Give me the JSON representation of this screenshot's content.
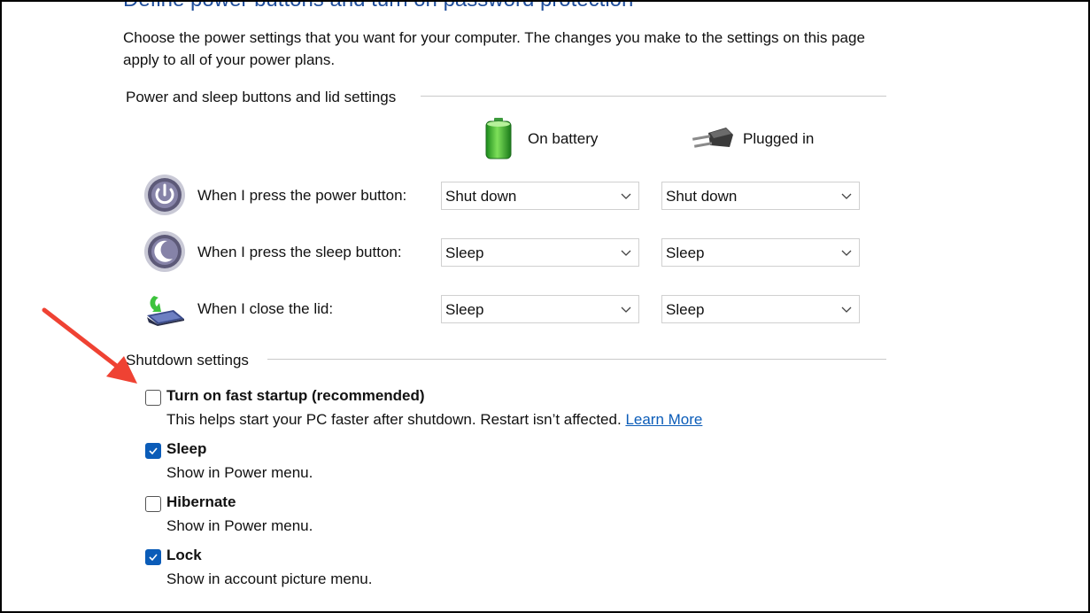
{
  "heading": "Define power buttons and turn on password protection",
  "intro": "Choose the power settings that you want for your computer. The changes you make to the settings on this page apply to all of your power plans.",
  "power_group": {
    "title": "Power and sleep buttons and lid settings",
    "col_battery": "On battery",
    "col_plugged": "Plugged in",
    "rows": [
      {
        "label": "When I press the power button:",
        "battery": "Shut down",
        "plugged": "Shut down",
        "icon": "power-button-icon"
      },
      {
        "label": "When I press the sleep button:",
        "battery": "Sleep",
        "plugged": "Sleep",
        "icon": "sleep-button-icon"
      },
      {
        "label": "When I close the lid:",
        "battery": "Sleep",
        "plugged": "Sleep",
        "icon": "laptop-lid-icon"
      }
    ]
  },
  "shutdown_group": {
    "title": "Shutdown settings",
    "options": [
      {
        "title": "Turn on fast startup (recommended)",
        "desc": "This helps start your PC faster after shutdown. Restart isn’t affected.",
        "link": "Learn More",
        "checked": false
      },
      {
        "title": "Sleep",
        "desc": "Show in Power menu.",
        "checked": true
      },
      {
        "title": "Hibernate",
        "desc": "Show in Power menu.",
        "checked": false
      },
      {
        "title": "Lock",
        "desc": "Show in account picture menu.",
        "checked": true
      }
    ]
  },
  "colors": {
    "accent": "#0b5cb8",
    "heading": "#1f4e9c",
    "arrow": "#ef4233"
  }
}
